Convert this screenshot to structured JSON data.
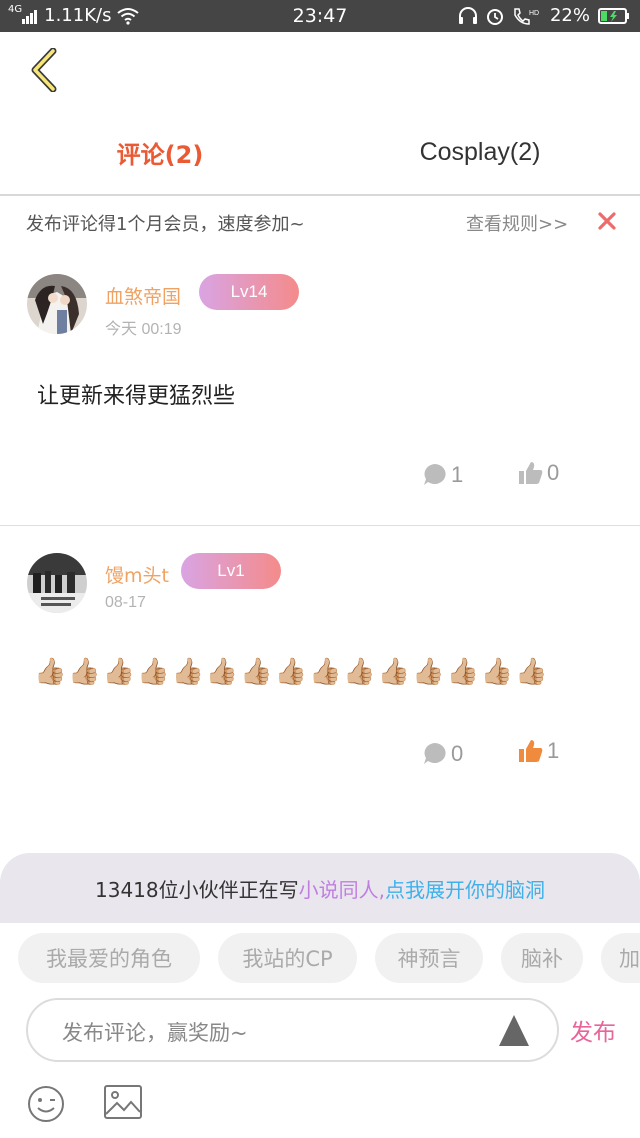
{
  "status_bar": {
    "network": "4G",
    "speed": "1.11K/s",
    "time": "23:47",
    "hd_label": "HD",
    "battery": "22%"
  },
  "tabs": [
    {
      "label": "评论(2)",
      "active": true
    },
    {
      "label": "Cosplay(2)",
      "active": false
    }
  ],
  "promo": {
    "text": "发布评论得1个月会员，速度参加~",
    "rules_link": "查看规则>>"
  },
  "comments": [
    {
      "username": "血煞帝国",
      "level": "Lv14",
      "time": "今天 00:19",
      "content": "让更新来得更猛烈些",
      "reply_count": "1",
      "like_count": "0",
      "liked": false
    },
    {
      "username": "馒m头t",
      "level": "Lv1",
      "time": "08-17",
      "content": "👍🏼👍🏼👍🏼👍🏼👍🏼👍🏼👍🏼👍🏼👍🏼👍🏼👍🏼👍🏼👍🏼👍🏼👍🏼",
      "reply_count": "0",
      "like_count": "1",
      "liked": true
    }
  ],
  "banner": {
    "prefix": "13418位小伙伴正在写",
    "highlight1": "小说同人,",
    "highlight2": "点我展开你的脑洞"
  },
  "chips": [
    "我最爱的角色",
    "我站的CP",
    "神预言",
    "脑补",
    "加"
  ],
  "input": {
    "placeholder": "发布评论，赢奖励~",
    "publish_label": "发布"
  },
  "colors": {
    "accent": "#ea5a35",
    "username": "#f0a262",
    "like_active": "#f08a3c",
    "publish": "#e8659a"
  },
  "icons": [
    "back-arrow-icon",
    "close-icon",
    "comment-bubble-icon",
    "thumbs-up-icon",
    "send-triangle-icon",
    "emoji-icon",
    "image-icon"
  ]
}
